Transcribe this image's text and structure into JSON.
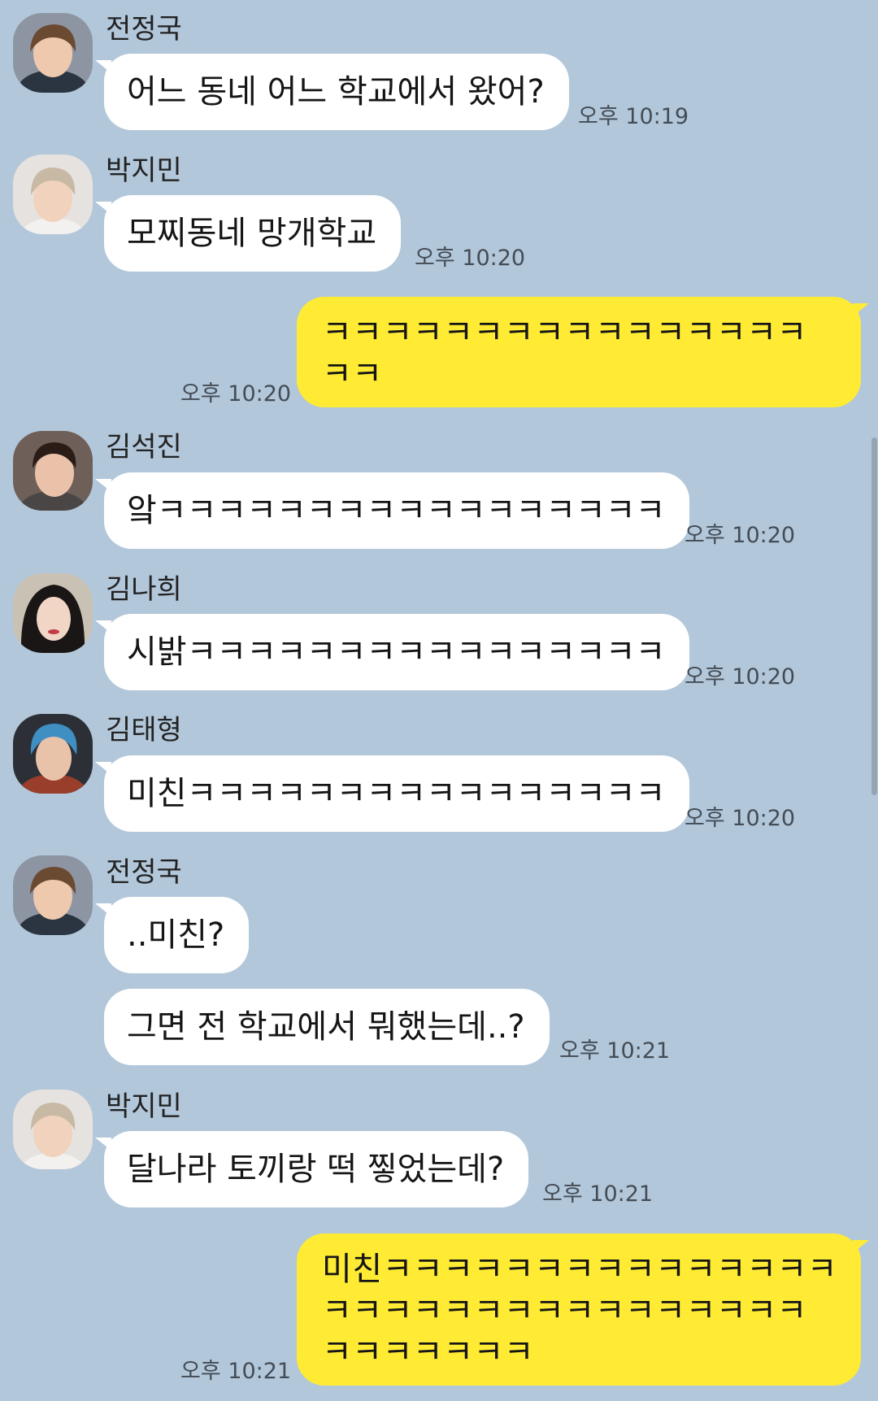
{
  "messages": {
    "m1": {
      "sender": "전정국",
      "text": "어느 동네 어느 학교에서 왔어?",
      "time": "오후 10:19"
    },
    "m2": {
      "sender": "박지민",
      "text": "모찌동네 망개학교",
      "time": "오후 10:20"
    },
    "m3": {
      "lines": [
        "ㅋㅋㅋㅋㅋㅋㅋㅋㅋㅋㅋㅋㅋㅋㅋㅋ",
        "ㅋㅋ"
      ],
      "time": "오후 10:20"
    },
    "m4": {
      "sender": "김석진",
      "text": "앜ㅋㅋㅋㅋㅋㅋㅋㅋㅋㅋㅋㅋㅋㅋㅋㅋㅋ",
      "time": "오후 10:20"
    },
    "m5": {
      "sender": "김나희",
      "text": "시밝ㅋㅋㅋㅋㅋㅋㅋㅋㅋㅋㅋㅋㅋㅋㅋㅋ",
      "time": "오후 10:20"
    },
    "m6": {
      "sender": "김태형",
      "text": "미친ㅋㅋㅋㅋㅋㅋㅋㅋㅋㅋㅋㅋㅋㅋㅋㅋ",
      "time": "오후 10:20"
    },
    "m7": {
      "sender": "전정국",
      "text": "..미친?"
    },
    "m8": {
      "text": "그면 전 학교에서 뭐했는데..?",
      "time": "오후 10:21"
    },
    "m9": {
      "sender": "박지민",
      "text": "달나라 토끼랑 떡 찧었는데?",
      "time": "오후 10:21"
    },
    "m10": {
      "lines": [
        "미친ㅋㅋㅋㅋㅋㅋㅋㅋㅋㅋㅋㅋㅋㅋㅋ",
        "ㅋㅋㅋㅋㅋㅋㅋㅋㅋㅋㅋㅋㅋㅋㅋㅋ",
        "ㅋㅋㅋㅋㅋㅋㅋ"
      ],
      "time": "오후 10:21"
    }
  },
  "colors": {
    "background": "#b2c7da",
    "incoming_bubble": "#ffffff",
    "outgoing_bubble": "#ffeb33"
  }
}
